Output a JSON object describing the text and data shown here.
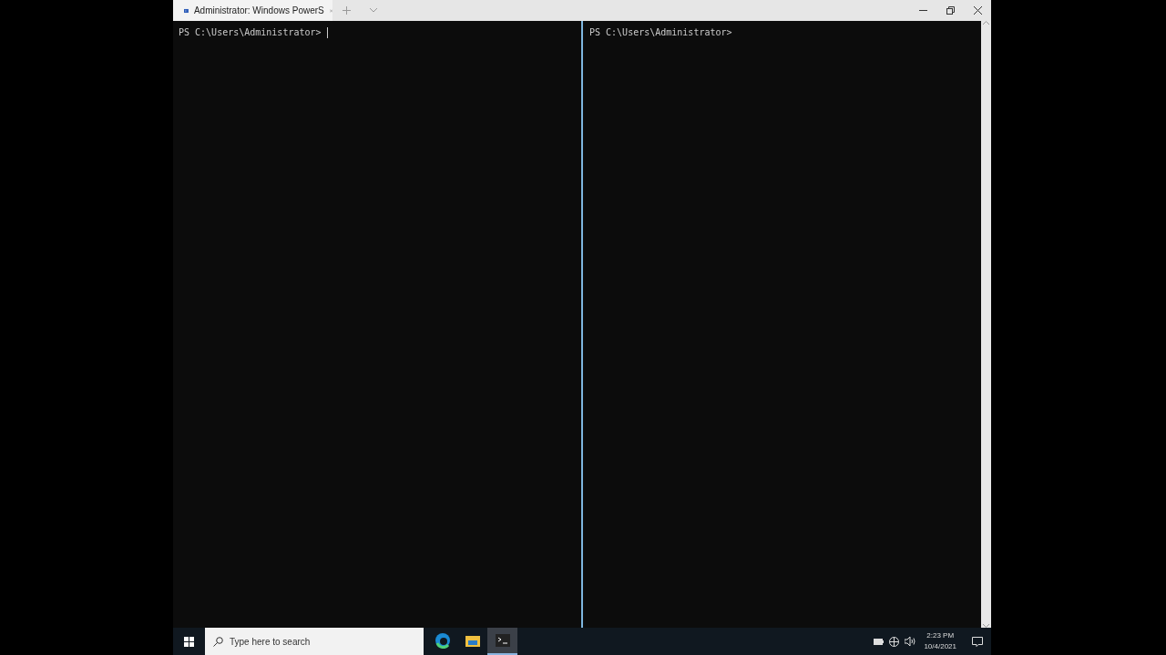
{
  "window": {
    "tab_title": "Administrator: Windows PowerS"
  },
  "panes": [
    {
      "prompt": "PS C:\\Users\\Administrator>",
      "focused": true
    },
    {
      "prompt": "PS C:\\Users\\Administrator>",
      "focused": false
    }
  ],
  "taskbar": {
    "search": {
      "placeholder": "Type here to search"
    },
    "apps": [
      {
        "kind": "browser",
        "selected": false
      },
      {
        "kind": "folder",
        "selected": false
      },
      {
        "kind": "terminal",
        "selected": true
      }
    ],
    "clock": {
      "time": "2:23 PM",
      "date": "10/4/2021"
    }
  }
}
